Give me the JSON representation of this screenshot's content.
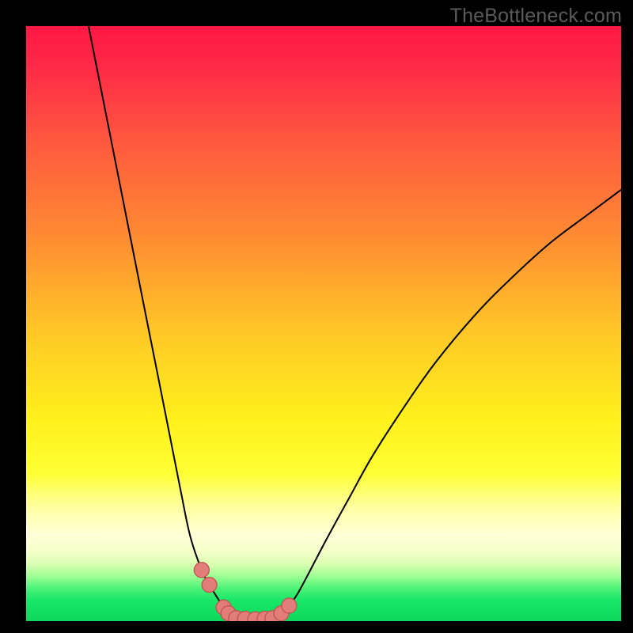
{
  "watermark": {
    "text": "TheBottleneck.com"
  },
  "chart_data": {
    "type": "line",
    "title": "",
    "xlabel": "",
    "ylabel": "",
    "xlim": [
      0,
      100
    ],
    "ylim": [
      0,
      100
    ],
    "grid": false,
    "legend": false,
    "series": [
      {
        "name": "left-curve",
        "x": [
          10.5,
          12,
          14,
          16,
          18,
          20,
          22,
          24,
          26,
          27.6,
          29.5,
          30.8,
          32.1,
          33.2,
          34,
          35.3,
          36.6,
          38.5
        ],
        "y": [
          100,
          92.4,
          82.3,
          72.2,
          62.1,
          52.0,
          42.0,
          31.9,
          21.8,
          14.2,
          8.6,
          6.1,
          4.0,
          2.3,
          1.3,
          0.5,
          0.4,
          0.3
        ]
      },
      {
        "name": "flat-bottom",
        "x": [
          35.3,
          36.8,
          38.5,
          40.1,
          41.4
        ],
        "y": [
          0.5,
          0.4,
          0.3,
          0.4,
          0.5
        ]
      },
      {
        "name": "right-curve",
        "x": [
          41.4,
          42.9,
          44.2,
          45.5,
          47.1,
          50.4,
          54.4,
          58.3,
          63.6,
          68.9,
          75.5,
          81.4,
          88.0,
          94.5,
          100.0
        ],
        "y": [
          0.5,
          1.3,
          2.6,
          4.4,
          7.3,
          13.6,
          20.9,
          27.9,
          36.1,
          43.6,
          51.5,
          57.5,
          63.5,
          68.4,
          72.5
        ]
      },
      {
        "name": "dot-markers",
        "x": [
          29.5,
          30.8,
          33.2,
          34.0,
          35.3,
          36.8,
          38.5,
          40.1,
          41.4,
          42.9,
          44.2
        ],
        "y": [
          8.6,
          6.1,
          2.3,
          1.3,
          0.5,
          0.4,
          0.3,
          0.4,
          0.5,
          1.3,
          2.6
        ]
      }
    ],
    "gradient_stops": [
      {
        "offset": 0.0,
        "color": "#ff1744"
      },
      {
        "offset": 0.07,
        "color": "#ff2a47"
      },
      {
        "offset": 0.2,
        "color": "#ff5a3e"
      },
      {
        "offset": 0.35,
        "color": "#ff8a33"
      },
      {
        "offset": 0.52,
        "color": "#ffc926"
      },
      {
        "offset": 0.66,
        "color": "#fff01c"
      },
      {
        "offset": 0.75,
        "color": "#ffff33"
      },
      {
        "offset": 0.81,
        "color": "#ffffa3"
      },
      {
        "offset": 0.855,
        "color": "#ffffd8"
      },
      {
        "offset": 0.885,
        "color": "#f3ffc8"
      },
      {
        "offset": 0.905,
        "color": "#d8ffb0"
      },
      {
        "offset": 0.925,
        "color": "#9cff94"
      },
      {
        "offset": 0.945,
        "color": "#4cf377"
      },
      {
        "offset": 0.965,
        "color": "#17e768"
      },
      {
        "offset": 1.0,
        "color": "#0fd85b"
      }
    ],
    "marker_style": {
      "fill": "#e27d7a",
      "stroke": "#be5450",
      "stroke_width": 1.3,
      "radius": 9.5
    },
    "curve_style": {
      "stroke": "#000000",
      "stroke_width": 2.0
    }
  }
}
